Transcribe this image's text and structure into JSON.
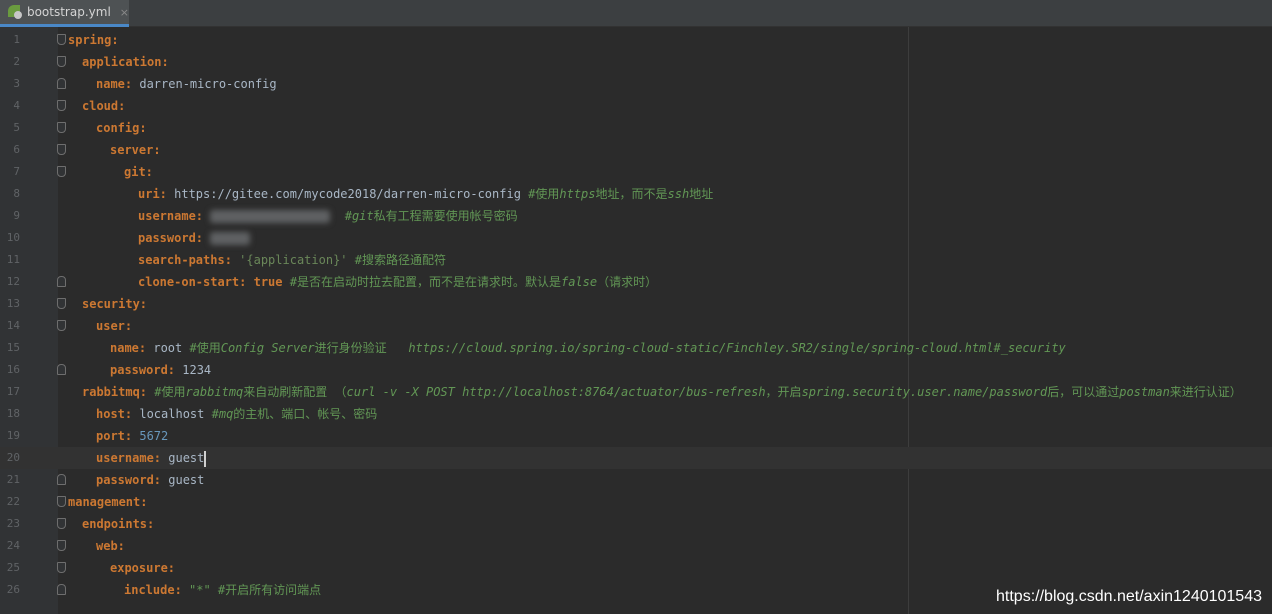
{
  "tab": {
    "label": "bootstrap.yml",
    "close": "×",
    "icon": "spring-yaml-icon"
  },
  "lines": [
    {
      "n": "1",
      "indent": 0,
      "key": "spring:"
    },
    {
      "n": "2",
      "indent": 1,
      "key": "application:"
    },
    {
      "n": "3",
      "indent": 2,
      "key": "name:",
      "val": " darren-micro-config"
    },
    {
      "n": "4",
      "indent": 1,
      "key": "cloud:"
    },
    {
      "n": "5",
      "indent": 2,
      "key": "config:"
    },
    {
      "n": "6",
      "indent": 3,
      "key": "server:"
    },
    {
      "n": "7",
      "indent": 4,
      "key": "git:"
    },
    {
      "n": "8",
      "indent": 5,
      "key": "uri:",
      "val": " https://gitee.com/mycode2018/darren-micro-config ",
      "c_pre": "#使用",
      "c_it": "https",
      "c_post": "地址，而不是",
      "c_it2": "ssh",
      "c_post2": "地址"
    },
    {
      "n": "9",
      "indent": 5,
      "key": "username:",
      "blur": "true",
      "c_pre": "#",
      "c_it": "git",
      "c_post": "私有工程需要使用帐号密码"
    },
    {
      "n": "10",
      "indent": 5,
      "key": "password:",
      "blur": "true"
    },
    {
      "n": "11",
      "indent": 5,
      "key": "search-paths:",
      "str": " '{application}' ",
      "c_pre": "#搜索路径通配符"
    },
    {
      "n": "12",
      "indent": 5,
      "key": "clone-on-start:",
      "kwv": " true ",
      "c_pre": "#是否在启动时拉去配置，而不是在请求时。默认是",
      "c_it": "false",
      "c_post": "（请求时）"
    },
    {
      "n": "13",
      "indent": 1,
      "key": "security:"
    },
    {
      "n": "14",
      "indent": 2,
      "key": "user:"
    },
    {
      "n": "15",
      "indent": 3,
      "key": "name:",
      "val": " root ",
      "c_pre": "#使用",
      "c_it": "Config Server",
      "c_post": "进行身份验证   ",
      "c_it2": "https://cloud.spring.io/spring-cloud-static/Finchley.SR2/single/spring-cloud.html#_security"
    },
    {
      "n": "16",
      "indent": 3,
      "key": "password:",
      "val": " 1234"
    },
    {
      "n": "17",
      "indent": 1,
      "key": "rabbitmq:",
      "c_pre": " #使用",
      "c_it": "rabbitmq",
      "c_post": "来自动刷新配置 （",
      "c_it2": "curl -v -X POST http://localhost:8764/actuator/bus-refresh",
      "c_post2": "，开启",
      "c_it3": "spring.security.user.name/password",
      "c_post3": "后，可以通过",
      "c_it4": "postman",
      "c_post4": "来进行认证）"
    },
    {
      "n": "18",
      "indent": 2,
      "key": "host:",
      "val": " localhost ",
      "c_pre": "#",
      "c_it": "mq",
      "c_post": "的主机、端口、帐号、密码"
    },
    {
      "n": "19",
      "indent": 2,
      "key": "port:",
      "num": " 5672"
    },
    {
      "n": "20",
      "indent": 2,
      "key": "username:",
      "val": " guest",
      "caret": "true",
      "current": "true"
    },
    {
      "n": "21",
      "indent": 2,
      "key": "password:",
      "val": " guest"
    },
    {
      "n": "22",
      "indent": 0,
      "key": "management:"
    },
    {
      "n": "23",
      "indent": 1,
      "key": "endpoints:"
    },
    {
      "n": "24",
      "indent": 2,
      "key": "web:"
    },
    {
      "n": "25",
      "indent": 3,
      "key": "exposure:"
    },
    {
      "n": "26",
      "indent": 4,
      "key": "include:",
      "ci_val": " \"*\" ",
      "c_pre": "#开启所有访问端点"
    }
  ],
  "watermark": "https://blog.csdn.net/axin1240101543"
}
